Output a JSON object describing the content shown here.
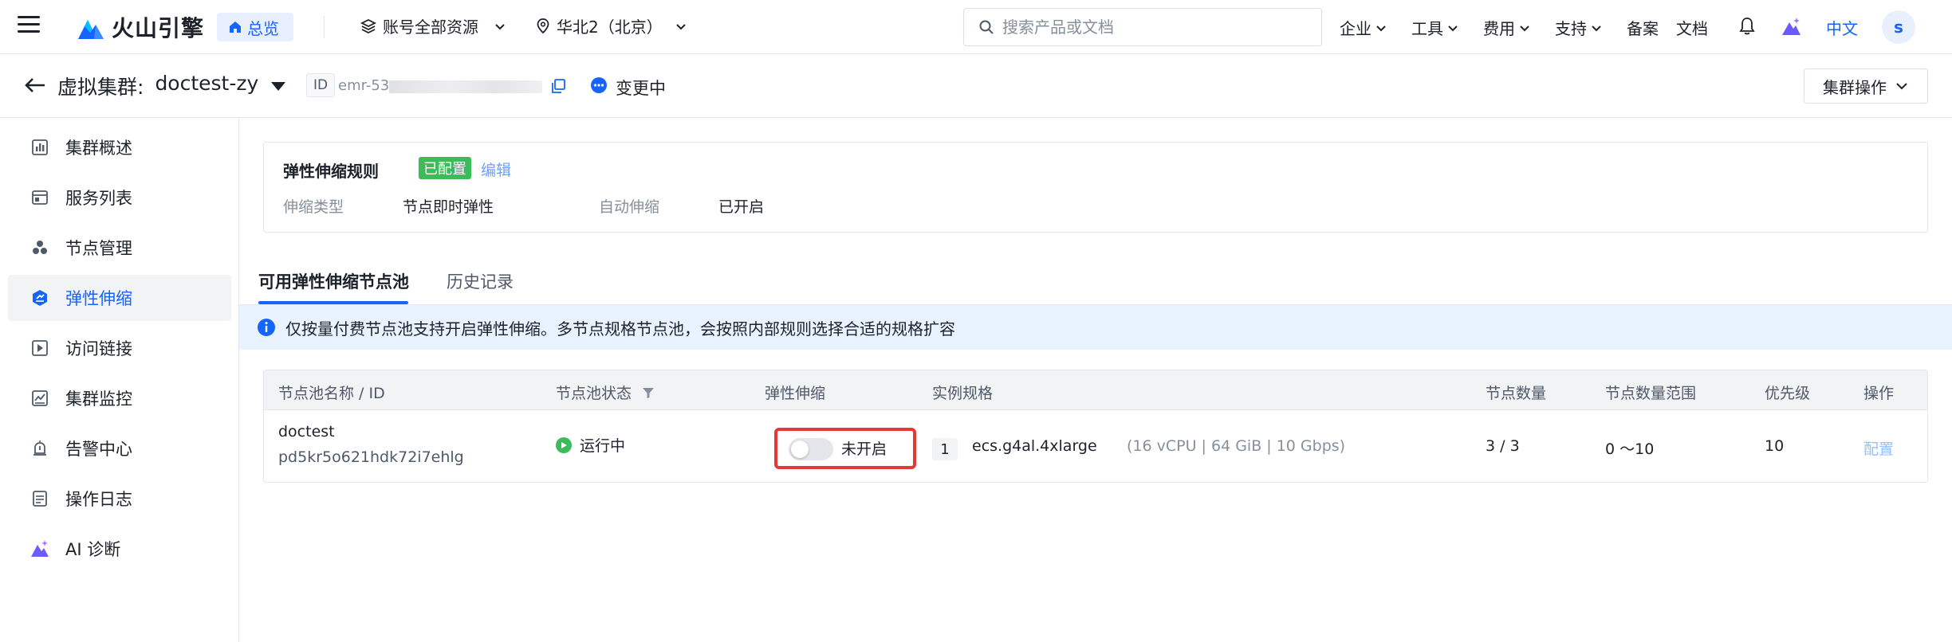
{
  "topnav": {
    "logo_text": "火山引擎",
    "overview_label": "总览",
    "resources_label": "账号全部资源",
    "region_label": "华北2（北京）",
    "search_placeholder": "搜索产品或文档",
    "menu": {
      "enterprise": "企业",
      "tools": "工具",
      "billing": "费用",
      "support": "支持",
      "icp": "备案",
      "docs": "文档"
    },
    "language": "中文",
    "avatar_letter": "s"
  },
  "subheader": {
    "title_prefix": "虚拟集群:",
    "cluster_name": "doctest-zy",
    "id_label": "ID",
    "id_value": "emr-53",
    "status": "变更中",
    "cluster_ops_label": "集群操作"
  },
  "sidebar": {
    "items": [
      {
        "label": "集群概述",
        "icon": "bar-chart-icon"
      },
      {
        "label": "服务列表",
        "icon": "service-list-icon"
      },
      {
        "label": "节点管理",
        "icon": "node-cluster-icon"
      },
      {
        "label": "弹性伸缩",
        "icon": "autoscale-icon"
      },
      {
        "label": "访问链接",
        "icon": "access-link-icon"
      },
      {
        "label": "集群监控",
        "icon": "monitor-icon"
      },
      {
        "label": "告警中心",
        "icon": "alarm-icon"
      },
      {
        "label": "操作日志",
        "icon": "log-icon"
      },
      {
        "label": "AI 诊断",
        "icon": "ai-diagnosis-icon"
      }
    ],
    "active_index": 3
  },
  "rule_card": {
    "title": "弹性伸缩规则",
    "tag": "已配置",
    "edit_label": "编辑",
    "scale_type_key": "伸缩类型",
    "scale_type_value": "节点即时弹性",
    "auto_scale_key": "自动伸缩",
    "auto_scale_value": "已开启"
  },
  "tabs": [
    {
      "label": "可用弹性伸缩节点池"
    },
    {
      "label": "历史记录"
    }
  ],
  "alert_text": "仅按量付费节点池支持开启弹性伸缩。多节点规格节点池，会按照内部规则选择合适的规格扩容",
  "table": {
    "headers": [
      "节点池名称 / ID",
      "节点池状态",
      "弹性伸缩",
      "实例规格",
      "节点数量",
      "节点数量范围",
      "优先级",
      "操作"
    ],
    "rows": [
      {
        "name": "doctest",
        "id": "pd5kr5o621hdk72i7ehlg",
        "status": "运行中",
        "autoscale": "未开启",
        "spec_count": "1",
        "spec_name": "ecs.g4al.4xlarge",
        "spec_detail": "(16 vCPU | 64 GiB | 10 Gbps)",
        "node_count": "3 / 3",
        "node_range": "0 ～10",
        "priority": "10",
        "action": "配置"
      }
    ]
  },
  "colors": {
    "brand": "#1664ff",
    "success": "#3cbb5a",
    "highlight_box": "#e53935"
  }
}
